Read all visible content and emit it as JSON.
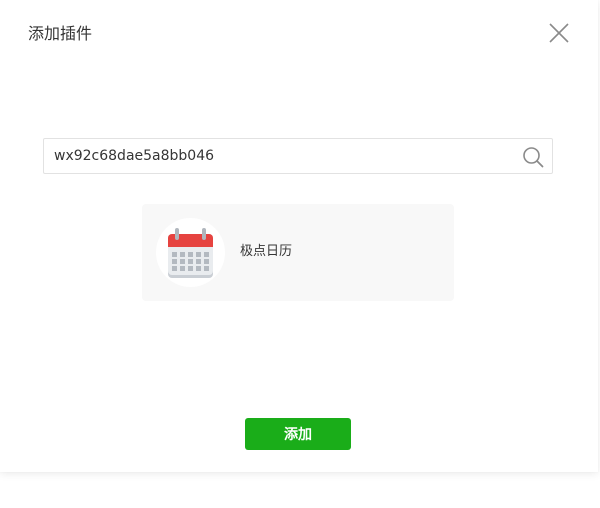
{
  "dialog": {
    "title": "添加插件",
    "close_icon": "close-icon"
  },
  "search": {
    "value": "wx92c68dae5a8bb046",
    "icon": "search-icon"
  },
  "results": [
    {
      "name": "极点日历",
      "icon": "calendar-icon"
    }
  ],
  "actions": {
    "add_label": "添加"
  },
  "colors": {
    "accent": "#1aad19",
    "card_bg": "#f8f8f8",
    "text": "#353535",
    "calendar_red": "#e64340",
    "calendar_body": "#e9ecef"
  }
}
